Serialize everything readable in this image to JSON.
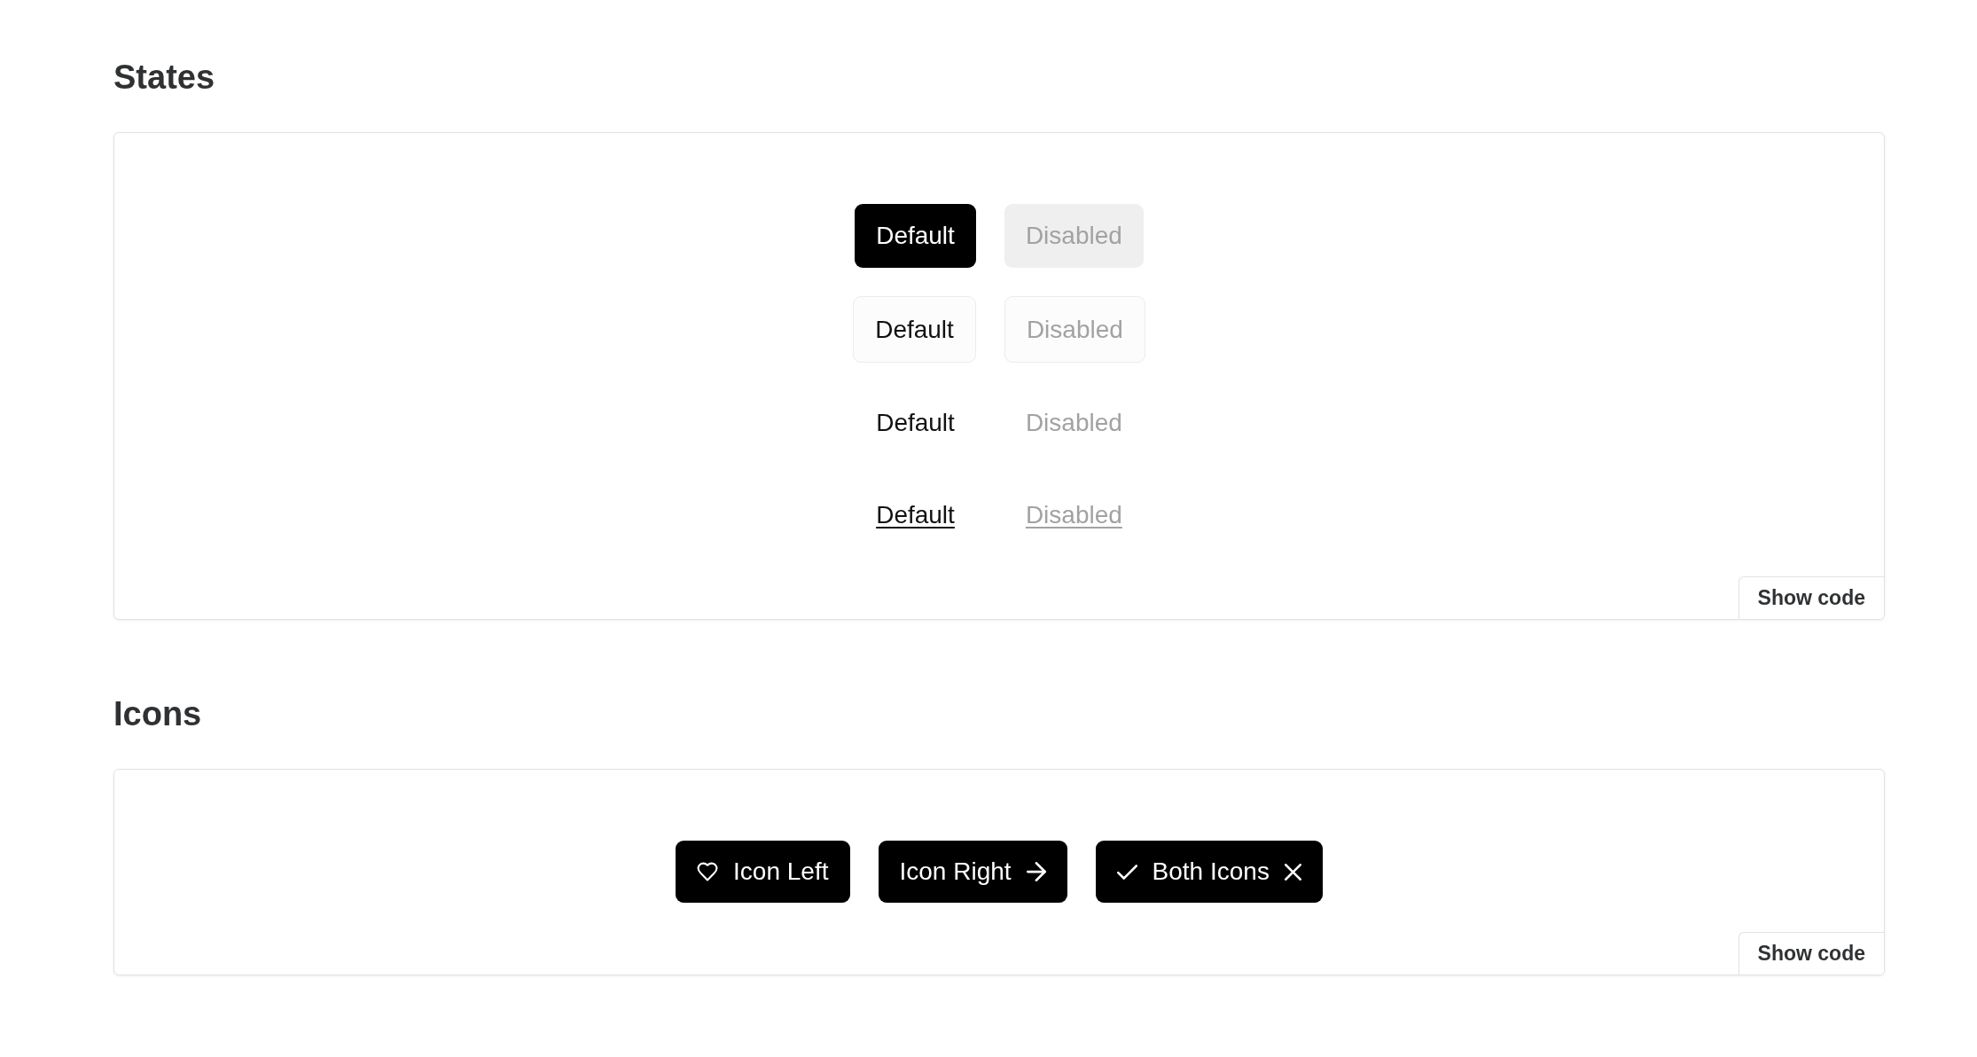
{
  "sections": [
    {
      "title": "States",
      "kind": "states",
      "rows": [
        {
          "kind": "solid",
          "buttons": [
            {
              "label": "Default",
              "disabled": false
            },
            {
              "label": "Disabled",
              "disabled": true
            }
          ]
        },
        {
          "kind": "outline",
          "buttons": [
            {
              "label": "Default",
              "disabled": false
            },
            {
              "label": "Disabled",
              "disabled": true
            }
          ]
        },
        {
          "kind": "ghost",
          "buttons": [
            {
              "label": "Default",
              "disabled": false
            },
            {
              "label": "Disabled",
              "disabled": true
            }
          ]
        },
        {
          "kind": "link",
          "buttons": [
            {
              "label": "Default",
              "disabled": false
            },
            {
              "label": "Disabled",
              "disabled": true
            }
          ]
        }
      ],
      "show_code": "Show code"
    },
    {
      "title": "Icons",
      "kind": "icons",
      "buttons": [
        {
          "label": "Icon Left",
          "kind": "icon_left"
        },
        {
          "label": "Icon Right",
          "kind": "icon_right"
        },
        {
          "label": "Both Icons",
          "kind": "both_icons"
        }
      ],
      "show_code": "Show code"
    }
  ]
}
